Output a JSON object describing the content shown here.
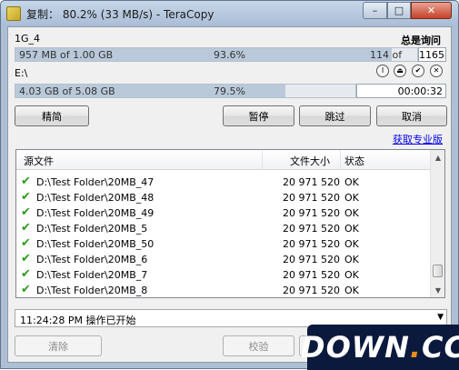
{
  "window": {
    "title": "复制： 80.2% (33 MB/s) - TeraCopy",
    "minimize_glyph": "–",
    "maximize_glyph": "□",
    "close_glyph": "✕"
  },
  "source": {
    "name": "1G_4",
    "ask_label": "总是询问",
    "progress_text": "957 MB of 1.00 GB",
    "percent_text": "93.6%",
    "percent": 93.6,
    "count_text": "114 of",
    "total_count": "1165"
  },
  "target": {
    "name": "E:\\",
    "progress_text": "4.03 GB of 5.08 GB",
    "percent_text": "79.5%",
    "percent": 79.5,
    "elapsed": "00:00:32"
  },
  "round_buttons": [
    {
      "glyph": "I",
      "icon": "pause-circle-icon"
    },
    {
      "glyph": "⏏",
      "icon": "eject-icon"
    },
    {
      "glyph": "✔",
      "icon": "check-circle-icon"
    },
    {
      "glyph": "✕",
      "icon": "close-circle-icon"
    }
  ],
  "buttons": {
    "compact": "精简",
    "pause": "暂停",
    "skip": "跳过",
    "cancel": "取消",
    "clear": "清除",
    "verify": "校验"
  },
  "pro_link": "获取专业版",
  "file_list": {
    "columns": {
      "source": "源文件",
      "size": "文件大小",
      "status": "状态"
    },
    "rows": [
      {
        "source": "D:\\Test Folder\\20MB_47",
        "size": "20 971 520",
        "status": "OK"
      },
      {
        "source": "D:\\Test Folder\\20MB_48",
        "size": "20 971 520",
        "status": "OK"
      },
      {
        "source": "D:\\Test Folder\\20MB_49",
        "size": "20 971 520",
        "status": "OK"
      },
      {
        "source": "D:\\Test Folder\\20MB_5",
        "size": "20 971 520",
        "status": "OK"
      },
      {
        "source": "D:\\Test Folder\\20MB_50",
        "size": "20 971 520",
        "status": "OK"
      },
      {
        "source": "D:\\Test Folder\\20MB_6",
        "size": "20 971 520",
        "status": "OK"
      },
      {
        "source": "D:\\Test Folder\\20MB_7",
        "size": "20 971 520",
        "status": "OK"
      },
      {
        "source": "D:\\Test Folder\\20MB_8",
        "size": "20 971 520",
        "status": "OK"
      }
    ]
  },
  "log_combo": {
    "value": "11:24:28 PM 操作已开始",
    "arrow": "▼"
  },
  "scroll": {
    "up": "▲",
    "down": "▼"
  },
  "watermark": {
    "main": "DOWN",
    "dot": ".",
    "tld": "CC"
  },
  "colors": {
    "check": "#2e9b1e",
    "link": "#0000ee",
    "bar_fill": "#b9c9da",
    "watermark_bg": "#0b1a3c"
  }
}
